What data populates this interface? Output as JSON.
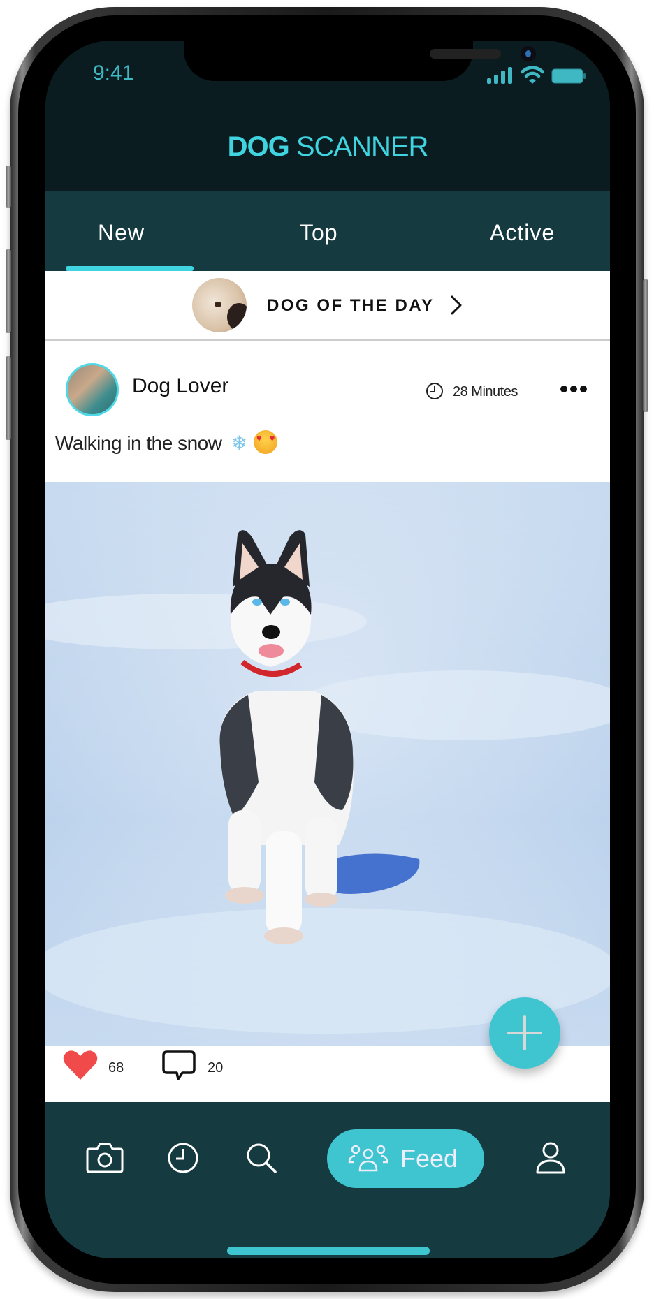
{
  "status_bar": {
    "time": "9:41",
    "icons": [
      "cellular-signal-icon",
      "wifi-icon",
      "battery-icon"
    ]
  },
  "app": {
    "title_bold": "DOG",
    "title_regular": " SCANNER",
    "accent_color": "#3fd4e0",
    "header_bg": "#0b1c20",
    "tab_bg": "#153a40"
  },
  "tabs": [
    {
      "label": "New",
      "active": true
    },
    {
      "label": "Top",
      "active": false
    },
    {
      "label": "Active",
      "active": false
    }
  ],
  "dog_of_the_day": {
    "label": "DOG OF THE DAY",
    "icon": "chevron-right-icon"
  },
  "post": {
    "username": "Dog Lover",
    "time_ago": "28 Minutes",
    "caption": "Walking in the snow",
    "caption_emojis": [
      "❄",
      "heart-eyes-emoji"
    ],
    "image_alt": "Husky puppy walking in the snow",
    "likes": "68",
    "comments": "20",
    "like_color": "#f04a4a"
  },
  "fab": {
    "icon": "plus-icon"
  },
  "bottom_nav": {
    "items": [
      {
        "name": "camera",
        "icon": "camera-icon"
      },
      {
        "name": "history",
        "icon": "clock-icon"
      },
      {
        "name": "search",
        "icon": "search-icon"
      },
      {
        "name": "feed",
        "icon": "group-icon",
        "label": "Feed",
        "active": true
      },
      {
        "name": "profile",
        "icon": "user-icon"
      }
    ]
  }
}
